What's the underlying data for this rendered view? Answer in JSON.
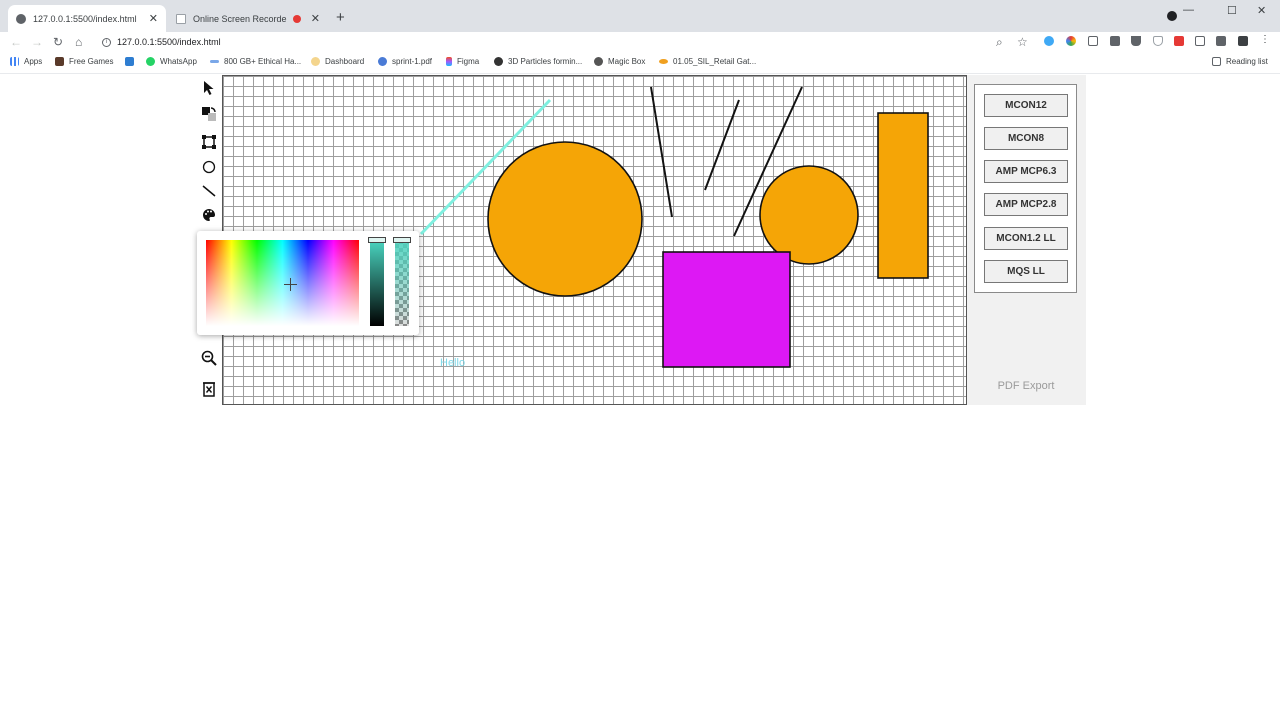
{
  "browser": {
    "tabs": [
      {
        "title": "127.0.0.1:5500/index.html",
        "active": true
      },
      {
        "title": "Online Screen Recorder",
        "active": false,
        "recording": true
      }
    ],
    "new_tab": "+",
    "window_controls": {
      "minimize": "—",
      "maximize": "☐",
      "close": "✕"
    },
    "url": "127.0.0.1:5500/index.html",
    "bookmarks": [
      {
        "label": "Apps",
        "color": "#4285f4"
      },
      {
        "label": "Free Games",
        "color": "#5a3a2a"
      },
      {
        "label": "",
        "color": "#2e7dd1"
      },
      {
        "label": "WhatsApp",
        "color": "#25d366"
      },
      {
        "label": "800 GB+ Ethical Ha...",
        "color": "#7aa7e8"
      },
      {
        "label": "Dashboard",
        "color": "#f4d58d"
      },
      {
        "label": "sprint-1.pdf",
        "color": "#4a7bd6"
      },
      {
        "label": "Figma",
        "color": "#f24e1e"
      },
      {
        "label": "3D Particles formin...",
        "color": "#333333"
      },
      {
        "label": "Magic Box",
        "color": "#555555"
      },
      {
        "label": "01.05_SIL_Retail Gat...",
        "color": "#f0a020"
      }
    ],
    "reading_list": "Reading list"
  },
  "toolbar": {
    "tools": [
      {
        "name": "pointer-tool-icon"
      },
      {
        "name": "fill-tool-icon"
      },
      {
        "name": "rectangle-tool-icon"
      },
      {
        "name": "circle-tool-icon"
      },
      {
        "name": "line-tool-icon"
      },
      {
        "name": "palette-tool-icon"
      },
      {
        "name": "zoom-out-tool-icon"
      },
      {
        "name": "delete-tool-icon"
      }
    ]
  },
  "canvas": {
    "text_label": "Hello",
    "colors": {
      "orange": "#f5a506",
      "magenta": "#dd18f4",
      "cyan": "#7ff0e0",
      "stroke": "#111111"
    }
  },
  "color_picker": {
    "selected_color": "#4ad6c1"
  },
  "panel": {
    "buttons": [
      "MCON12",
      "MCON8",
      "AMP MCP6.3",
      "AMP MCP2.8",
      "MCON1.2 LL",
      "MQS LL"
    ],
    "pdf_export": "PDF Export"
  }
}
